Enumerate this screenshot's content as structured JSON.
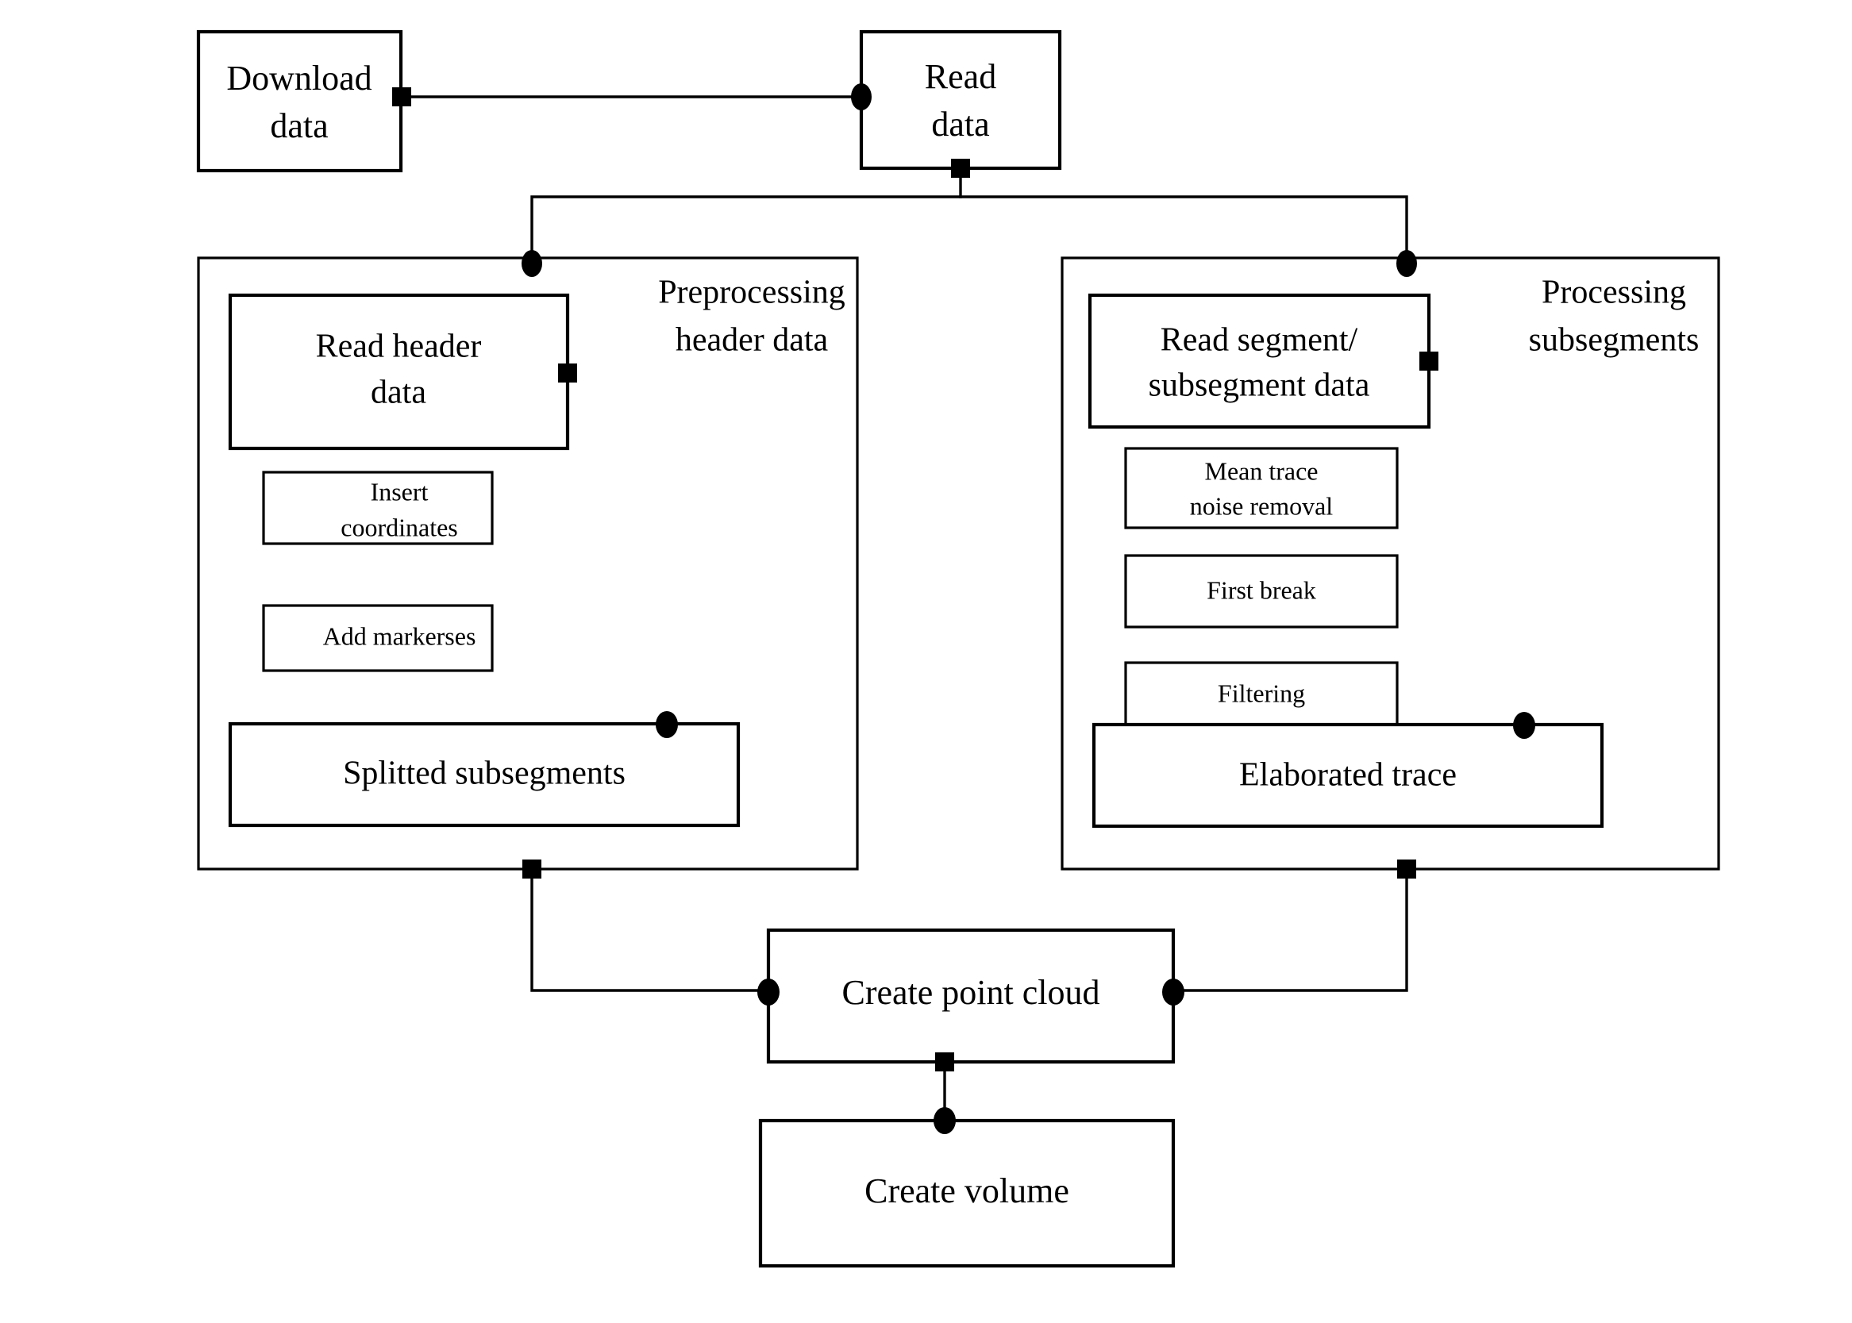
{
  "diagram": {
    "title": "Seismic data processing pipeline flowchart",
    "colors": {
      "stroke": "#000000",
      "fill": "#ffffff",
      "marker": "#000000"
    },
    "nodes": {
      "download_data": {
        "line1": "Download",
        "line2": "data"
      },
      "read_data": {
        "line1": "Read",
        "line2": "data"
      },
      "read_header_data": {
        "line1": "Read header",
        "line2": "data"
      },
      "insert_coordinates": {
        "line1": "Insert",
        "line2": "coordinates"
      },
      "add_markerses": {
        "line1": "Add markerses"
      },
      "splitted_subsegments": {
        "line1": "Splitted subsegments"
      },
      "read_segment_data": {
        "line1": "Read segment/",
        "line2": "subsegment data"
      },
      "mean_trace_noise_removal": {
        "line1": "Mean trace",
        "line2": "noise removal"
      },
      "first_break": {
        "line1": "First break"
      },
      "filtering": {
        "line1": "Filtering"
      },
      "elaborated_trace": {
        "line1": "Elaborated trace"
      },
      "create_point_cloud": {
        "line1": "Create point cloud"
      },
      "create_volume": {
        "line1": "Create volume"
      }
    },
    "groups": {
      "preprocessing": {
        "line1": "Preprocessing",
        "line2": "header data"
      },
      "processing": {
        "line1": "Processing",
        "line2": "subsegments"
      }
    }
  }
}
